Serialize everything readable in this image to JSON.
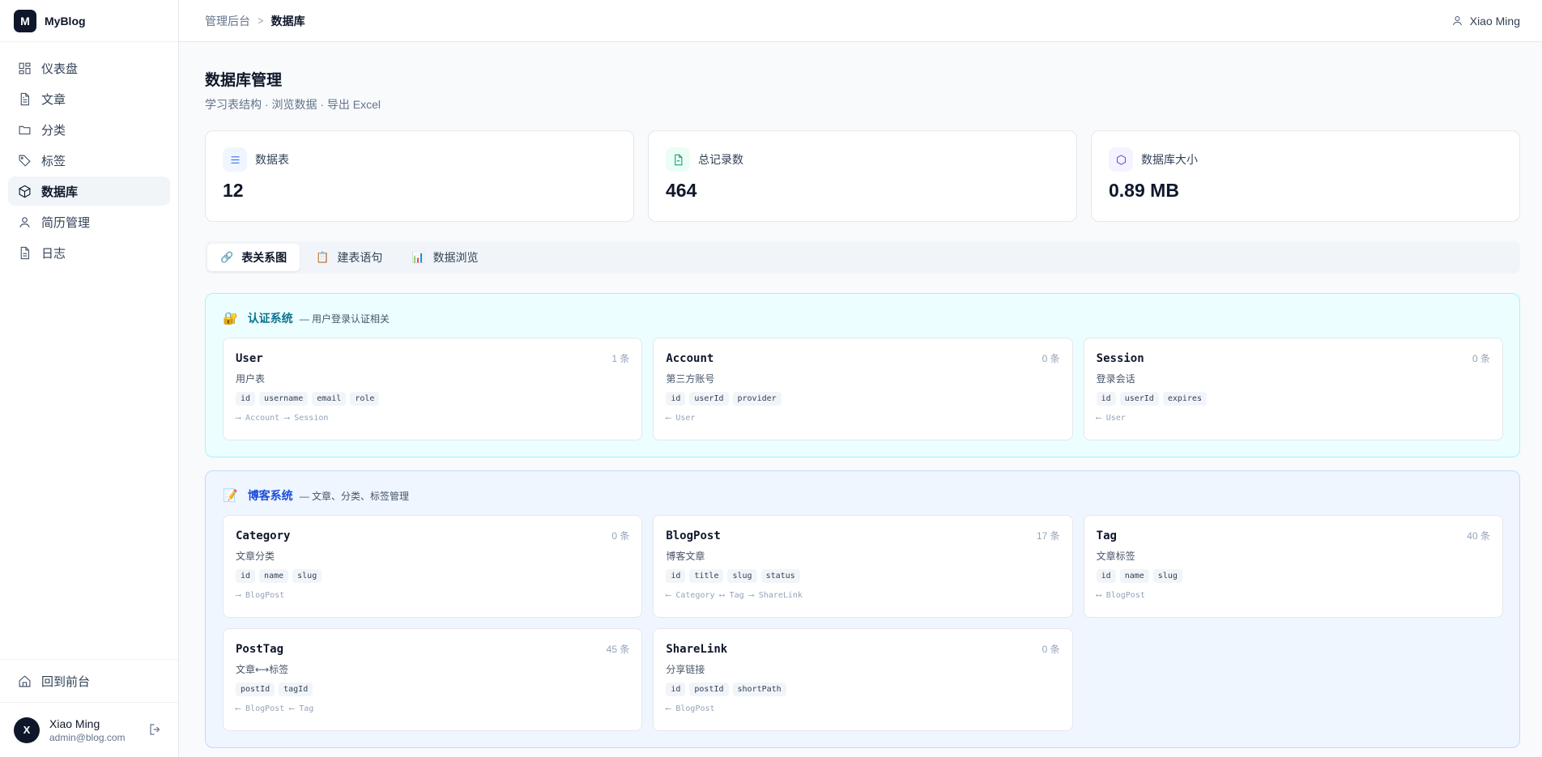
{
  "brand": {
    "logo_letter": "M",
    "name": "MyBlog"
  },
  "sidebar": {
    "items": [
      {
        "label": "仪表盘",
        "icon": "dashboard-icon"
      },
      {
        "label": "文章",
        "icon": "document-icon"
      },
      {
        "label": "分类",
        "icon": "folder-icon"
      },
      {
        "label": "标签",
        "icon": "tag-icon"
      },
      {
        "label": "数据库",
        "icon": "box-icon",
        "active": true
      },
      {
        "label": "简历管理",
        "icon": "user-icon"
      },
      {
        "label": "日志",
        "icon": "log-icon"
      }
    ],
    "back_to_front": "回到前台",
    "user": {
      "initial": "X",
      "name": "Xiao Ming",
      "email": "admin@blog.com"
    }
  },
  "topbar": {
    "breadcrumbs": [
      "管理后台",
      "数据库"
    ],
    "separator": ">",
    "user_name": "Xiao Ming"
  },
  "page": {
    "title": "数据库管理",
    "subtitle": "学习表结构 · 浏览数据 · 导出 Excel"
  },
  "stats": [
    {
      "label": "数据表",
      "value": "12",
      "icon": "list-icon",
      "color": "#2563eb"
    },
    {
      "label": "总记录数",
      "value": "464",
      "icon": "file-icon",
      "color": "#059669"
    },
    {
      "label": "数据库大小",
      "value": "0.89 MB",
      "icon": "hexagon-icon",
      "color": "#7c3aed"
    }
  ],
  "tabs": [
    {
      "emoji": "🔗",
      "label": "表关系图",
      "active": true
    },
    {
      "emoji": "📋",
      "label": "建表语句"
    },
    {
      "emoji": "📊",
      "label": "数据浏览"
    }
  ],
  "groups": {
    "auth": {
      "emoji": "🔐",
      "name": "认证系统",
      "desc": "— 用户登录认证相关",
      "tables": [
        {
          "name": "User",
          "count": "1 条",
          "desc": "用户表",
          "fields": [
            "id",
            "username",
            "email",
            "role"
          ],
          "rels": "⟶ Account ⟶ Session"
        },
        {
          "name": "Account",
          "count": "0 条",
          "desc": "第三方账号",
          "fields": [
            "id",
            "userId",
            "provider"
          ],
          "rels": "⟵ User"
        },
        {
          "name": "Session",
          "count": "0 条",
          "desc": "登录会话",
          "fields": [
            "id",
            "userId",
            "expires"
          ],
          "rels": "⟵ User"
        }
      ]
    },
    "blog": {
      "emoji": "📝",
      "name": "博客系统",
      "desc": "— 文章、分类、标签管理",
      "tables": [
        {
          "name": "Category",
          "count": "0 条",
          "desc": "文章分类",
          "fields": [
            "id",
            "name",
            "slug"
          ],
          "rels": "⟶ BlogPost"
        },
        {
          "name": "BlogPost",
          "count": "17 条",
          "desc": "博客文章",
          "fields": [
            "id",
            "title",
            "slug",
            "status"
          ],
          "rels": "⟵ Category ⟷ Tag ⟶ ShareLink"
        },
        {
          "name": "Tag",
          "count": "40 条",
          "desc": "文章标签",
          "fields": [
            "id",
            "name",
            "slug"
          ],
          "rels": "⟷ BlogPost"
        },
        {
          "name": "PostTag",
          "count": "45 条",
          "desc": "文章⟷标签",
          "fields": [
            "postId",
            "tagId"
          ],
          "rels": "⟵ BlogPost ⟵ Tag"
        },
        {
          "name": "ShareLink",
          "count": "0 条",
          "desc": "分享链接",
          "fields": [
            "id",
            "postId",
            "shortPath"
          ],
          "rels": "⟵ BlogPost"
        }
      ]
    }
  }
}
